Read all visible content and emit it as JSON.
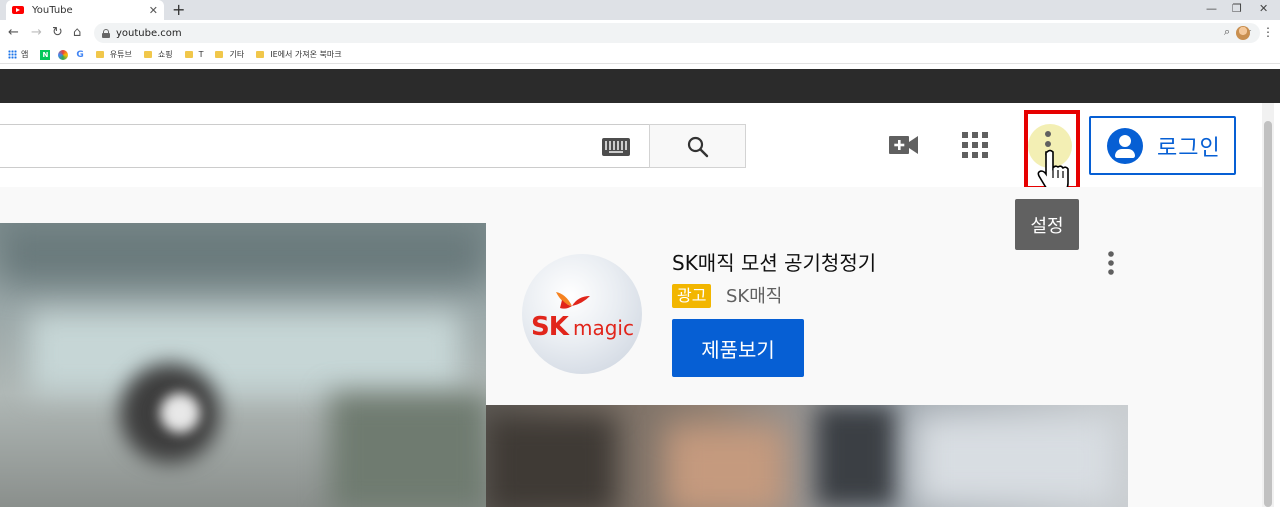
{
  "browser": {
    "tab_title": "YouTube",
    "tab_close": "✕",
    "new_tab": "+",
    "window_minimize": "—",
    "window_restore": "❐",
    "window_close": "✕",
    "url": "youtube.com",
    "bookmarks": [
      {
        "label": "앱",
        "icon": "apps-icon"
      },
      {
        "label": "",
        "icon": "naver-icon"
      },
      {
        "label": "",
        "icon": "daum-icon"
      },
      {
        "label": "",
        "icon": "google-icon"
      },
      {
        "label": "유튜브",
        "icon": "folder-icon"
      },
      {
        "label": "쇼핑",
        "icon": "folder-icon"
      },
      {
        "label": "T",
        "icon": "folder-icon"
      },
      {
        "label": "기타",
        "icon": "folder-icon"
      },
      {
        "label": "IE에서 가져온 북마크",
        "icon": "folder-icon"
      }
    ]
  },
  "header": {
    "login_label": "로그인",
    "settings_tooltip": "설정"
  },
  "ad": {
    "title": "SK매직 모션 공기청정기",
    "badge": "광고",
    "advertiser": "SK매직",
    "cta": "제품보기",
    "logo_sk": "SK",
    "logo_magic": "magic"
  },
  "colors": {
    "accent": "#065fd4",
    "highlight_box": "#e60000",
    "badge": "#f2b600",
    "brand_red": "#e1251b"
  }
}
